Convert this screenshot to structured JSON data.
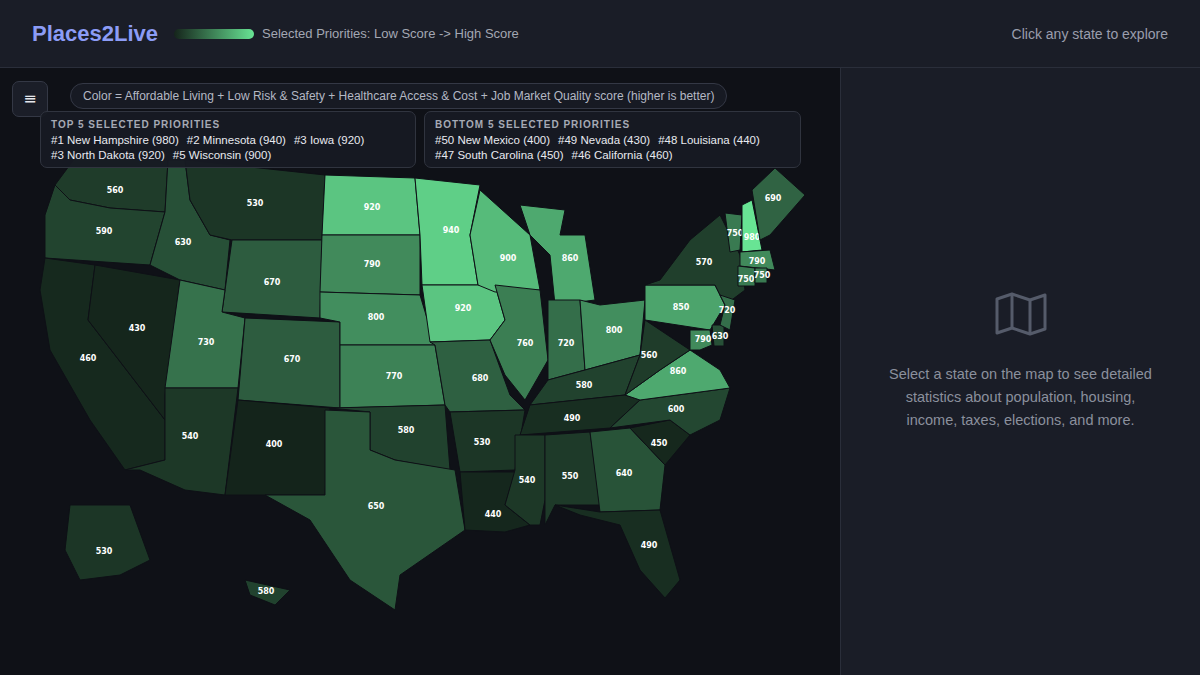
{
  "header": {
    "logo": "Places2Live",
    "legend": "Selected Priorities: Low Score -> High Score",
    "hint": "Click any state to explore"
  },
  "map": {
    "menu_icon": "≡",
    "caption": "Color = Affordable Living + Low Risk & Safety + Healthcare Access & Cost + Job Market Quality score (higher is better)",
    "top": {
      "title": "TOP 5 SELECTED PRIORITIES",
      "items": [
        "#1 New Hampshire (980)",
        "#2 Minnesota (940)",
        "#3 Iowa (920)",
        "#3 North Dakota (920)",
        "#5 Wisconsin (900)"
      ]
    },
    "bottom": {
      "title": "BOTTOM 5 SELECTED PRIORITIES",
      "items": [
        "#50 New Mexico (400)",
        "#49 Nevada (430)",
        "#48 Louisiana (440)",
        "#47 South Carolina (450)",
        "#46 California (460)"
      ]
    },
    "states": [
      {
        "score": "560"
      },
      {
        "score": "590"
      },
      {
        "score": "460"
      },
      {
        "score": "430"
      },
      {
        "score": "630"
      },
      {
        "score": "530"
      },
      {
        "score": "670"
      },
      {
        "score": "730"
      },
      {
        "score": "670"
      },
      {
        "score": "540"
      },
      {
        "score": "400"
      },
      {
        "score": "920"
      },
      {
        "score": "790"
      },
      {
        "score": "800"
      },
      {
        "score": "770"
      },
      {
        "score": "580"
      },
      {
        "score": "650"
      },
      {
        "score": "940"
      },
      {
        "score": "920"
      },
      {
        "score": "680"
      },
      {
        "score": "530"
      },
      {
        "score": "440"
      },
      {
        "score": "900"
      },
      {
        "score": "760"
      },
      {
        "score": "860"
      },
      {
        "score": "720"
      },
      {
        "score": "800"
      },
      {
        "score": "580"
      },
      {
        "score": "490"
      },
      {
        "score": "540"
      },
      {
        "score": "550"
      },
      {
        "score": "640"
      },
      {
        "score": "490"
      },
      {
        "score": "450"
      },
      {
        "score": "600"
      },
      {
        "score": "860"
      },
      {
        "score": "560"
      },
      {
        "score": "850"
      },
      {
        "score": "570"
      },
      {
        "score": "790"
      },
      {
        "score": "630"
      },
      {
        "score": "720"
      },
      {
        "score": "750"
      },
      {
        "score": "980"
      },
      {
        "score": "690"
      },
      {
        "score": "790"
      },
      {
        "score": "750"
      },
      {
        "score": "750"
      },
      {
        "score": "530"
      },
      {
        "score": "580"
      }
    ]
  },
  "detail": {
    "message": "Select a state on the map to see detailed statistics about population, housing, income, taxes, elections, and more."
  }
}
